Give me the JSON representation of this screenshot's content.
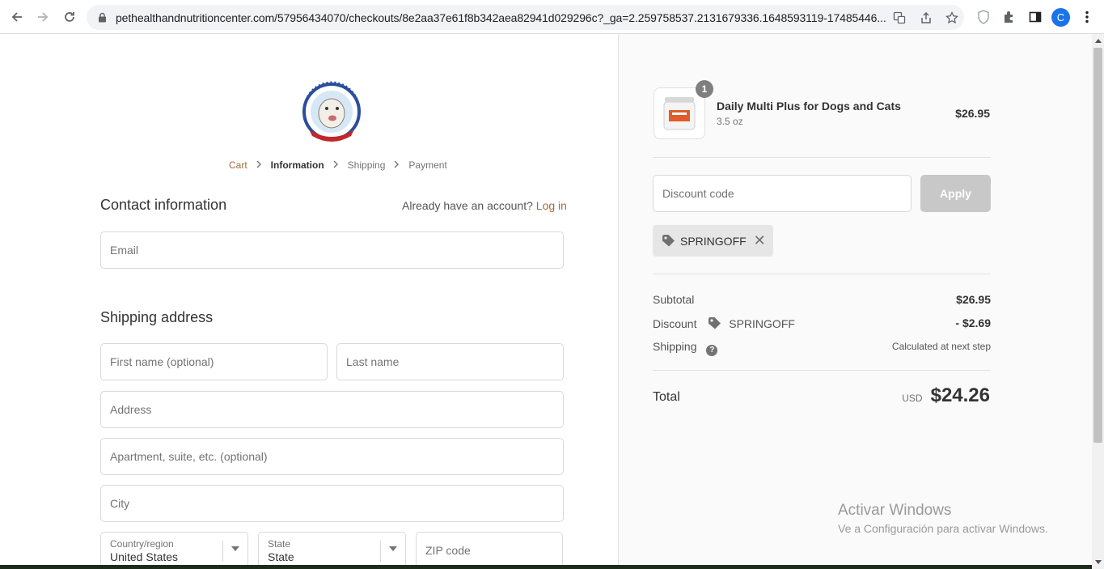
{
  "browser": {
    "url": "pethealthandnutritioncenter.com/57956434070/checkouts/8e2aa37e61f8b342aea82941d029296c?_ga=2.259758537.2131679336.1648593119-17485446...",
    "profile_initial": "C"
  },
  "breadcrumb": {
    "cart": "Cart",
    "information": "Information",
    "shipping": "Shipping",
    "payment": "Payment"
  },
  "contact": {
    "title": "Contact information",
    "account_prompt": "Already have an account?",
    "login_link": "Log in",
    "email_placeholder": "Email"
  },
  "shipping_address": {
    "title": "Shipping address",
    "first_name_placeholder": "First name (optional)",
    "last_name_placeholder": "Last name",
    "address_placeholder": "Address",
    "apartment_placeholder": "Apartment, suite, etc. (optional)",
    "city_placeholder": "City",
    "country_label": "Country/region",
    "country_value": "United States",
    "state_label": "State",
    "state_value": "State",
    "zip_placeholder": "ZIP code"
  },
  "order": {
    "product_name": "Daily Multi Plus for Dogs and Cats",
    "product_variant": "3.5 oz",
    "product_price": "$26.95",
    "quantity": "1",
    "discount_placeholder": "Discount code",
    "apply_label": "Apply",
    "applied_code": "SPRINGOFF",
    "subtotal_label": "Subtotal",
    "subtotal_value": "$26.95",
    "discount_label": "Discount",
    "discount_code": "SPRINGOFF",
    "discount_value": "- $2.69",
    "shipping_label": "Shipping",
    "shipping_value": "Calculated at next step",
    "total_label": "Total",
    "total_currency": "USD",
    "total_value": "$24.26"
  },
  "watermark": {
    "line1": "Activar Windows",
    "line2": "Ve a Configuración para activar Windows."
  },
  "colors": {
    "accent": "#a26b3c",
    "apply_disabled": "#c8c8c8",
    "sidebar_bg": "#fafafa"
  }
}
